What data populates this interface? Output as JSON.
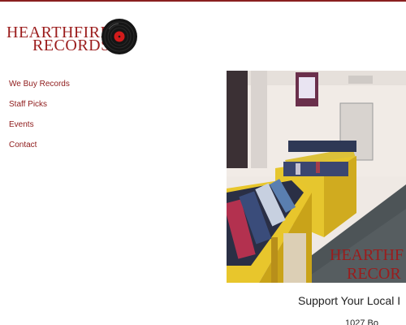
{
  "brand": {
    "line1": "HEARTHFIRE",
    "line2": "RECORDS",
    "color": "#9b1c1c"
  },
  "nav": {
    "items": [
      {
        "label": "We Buy Records"
      },
      {
        "label": "Staff Picks"
      },
      {
        "label": "Events"
      },
      {
        "label": "Contact"
      }
    ]
  },
  "hero": {
    "overlay_line1": "HEARTHF",
    "overlay_line2": "RECOR"
  },
  "main": {
    "tagline": "Support Your Local I",
    "address": "1027 Bo"
  },
  "colors": {
    "accent": "#8a1f1f",
    "shelf": "#e8c62c",
    "floor": "#4d5457"
  }
}
